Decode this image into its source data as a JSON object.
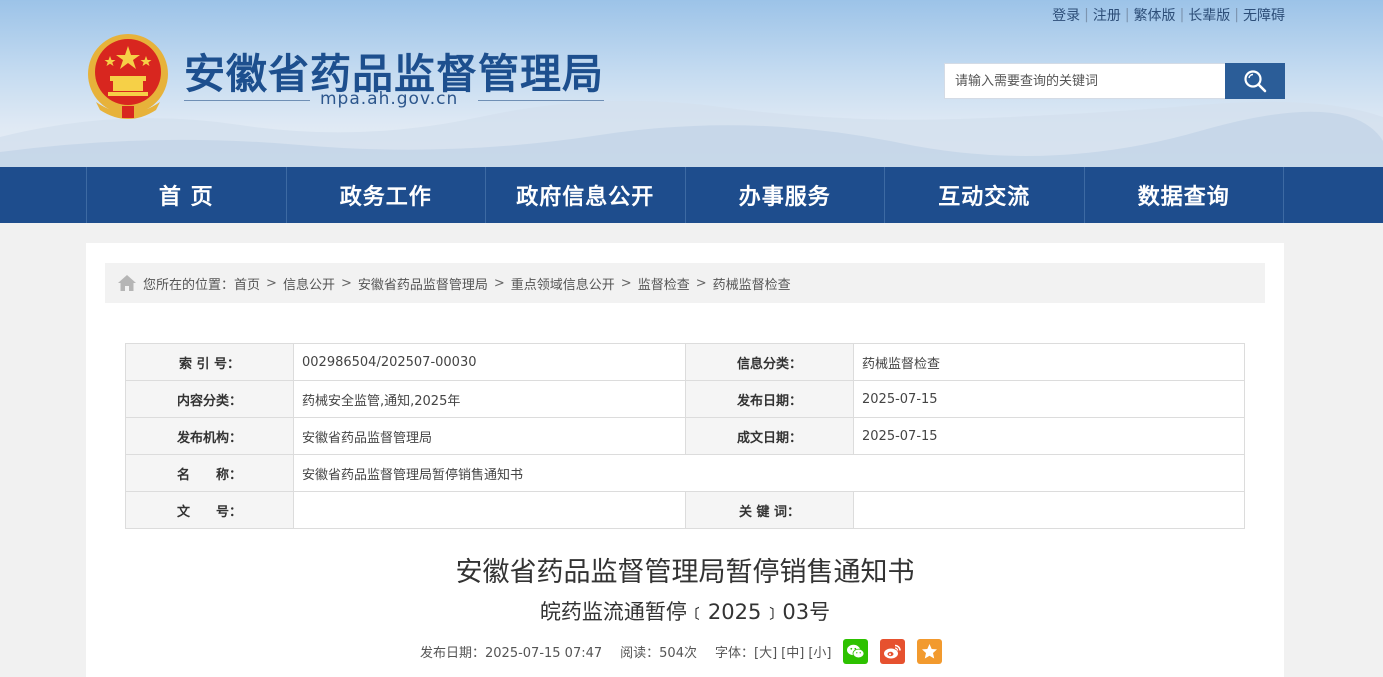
{
  "toplinks": {
    "login": "登录",
    "register": "注册",
    "traditional": "繁体版",
    "elder": "长辈版",
    "accessible": "无障碍"
  },
  "site": {
    "title": "安徽省药品监督管理局",
    "domain": "mpa.ah.gov.cn"
  },
  "search": {
    "placeholder": "请输入需要查询的关键词"
  },
  "nav": {
    "items": [
      {
        "label": "首 页"
      },
      {
        "label": "政务工作"
      },
      {
        "label": "政府信息公开"
      },
      {
        "label": "办事服务"
      },
      {
        "label": "互动交流"
      },
      {
        "label": "数据查询"
      }
    ]
  },
  "breadcrumb": {
    "prefix": "您所在的位置：",
    "items": [
      "首页",
      "信息公开",
      "安徽省药品监督管理局",
      "重点领域信息公开",
      "监督检查",
      "药械监督检查"
    ]
  },
  "meta": {
    "index_label": "索 引 号：",
    "index_value": "002986504/202507-00030",
    "category_label": "信息分类：",
    "category_value": "药械监督检查",
    "content_label": "内容分类：",
    "content_value": "药械安全监管,通知,2025年",
    "pubdate_label": "发布日期：",
    "pubdate_value": "2025-07-15",
    "org_label": "发布机构：",
    "org_value": "安徽省药品监督管理局",
    "writedate_label": "成文日期：",
    "writedate_value": "2025-07-15",
    "name_label": "名　　称：",
    "name_value": "安徽省药品监督管理局暂停销售通知书",
    "docno_label": "文　　号：",
    "docno_value": "",
    "keyword_label": "关 键 词：",
    "keyword_value": ""
  },
  "doc": {
    "title": "安徽省药品监督管理局暂停销售通知书",
    "number": "皖药监流通暂停﹝2025﹞03号",
    "pubdate": "发布日期：2025-07-15 07:47",
    "reads": "阅读：504次",
    "font_label": "字体：",
    "font_large": "[大]",
    "font_medium": "[中]",
    "font_small": "[小]"
  },
  "colors": {
    "nav_bg": "#1e4d8d",
    "title_blue": "#1d4f8e",
    "wechat": "#2dc100",
    "weibo": "#e6512f",
    "favorite": "#f29a2e"
  }
}
